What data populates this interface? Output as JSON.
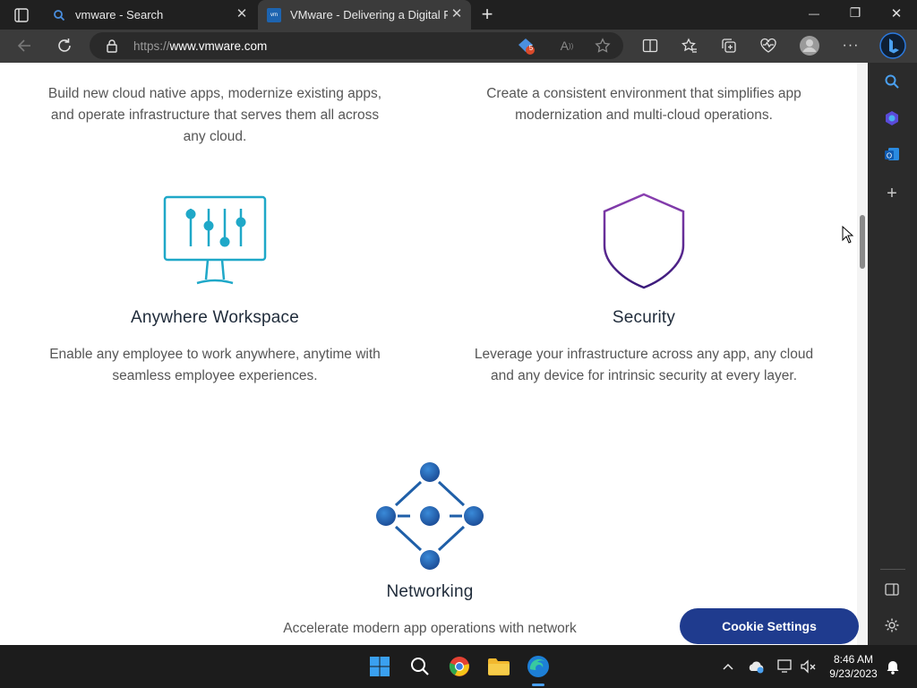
{
  "browser": {
    "tabs": [
      {
        "label": "vmware - Search",
        "favicon": "search-icon",
        "active": false
      },
      {
        "label": "VMware - Delivering a Digital Fo",
        "favicon": "vmware-favicon",
        "active": true
      }
    ],
    "new_tab_label": "+",
    "window_controls": {
      "minimize": "—",
      "restore": "❐",
      "close": "✕"
    },
    "address": {
      "prefix": "https://",
      "host": "www.vmware.com"
    },
    "extension_badge": "5"
  },
  "page": {
    "top_left_paragraph": "Build new cloud native apps, modernize existing apps, and operate infrastructure that serves them all across any cloud.",
    "top_right_paragraph": "Create a consistent environment that simplifies app modernization and multi-cloud operations.",
    "features": [
      {
        "title": "Anywhere Workspace",
        "description": "Enable any employee to work anywhere, anytime with seamless employee experiences.",
        "icon": "monitor-sliders-icon"
      },
      {
        "title": "Security",
        "description": "Leverage your infrastructure across any app, any cloud and any device for intrinsic security at every layer.",
        "icon": "shield-icon"
      },
      {
        "title": "Networking",
        "description": "Accelerate modern app operations with network",
        "icon": "network-nodes-icon"
      }
    ],
    "cookie_button": "Cookie Settings"
  },
  "taskbar": {
    "time": "8:46 AM",
    "date": "9/23/2023"
  },
  "colors": {
    "workspace_icon": "#1fa8c8",
    "security_icon": "#5a2a8e",
    "network_icon": "#1f5fa8",
    "cookie_button": "#1f3b8e"
  }
}
